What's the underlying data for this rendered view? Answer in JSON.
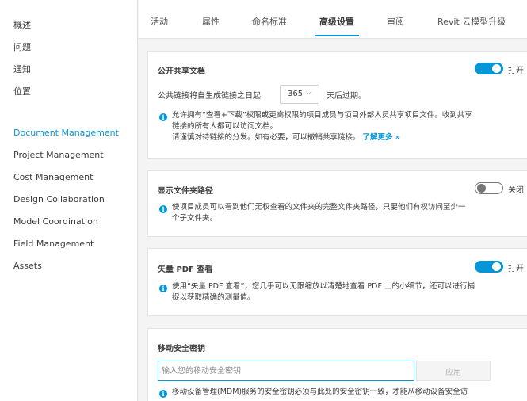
{
  "sidebar": {
    "items": [
      {
        "label": "概述"
      },
      {
        "label": "问题"
      },
      {
        "label": "通知"
      },
      {
        "label": "位置"
      },
      {
        "label": "Document Management",
        "active": true
      },
      {
        "label": "Project Management"
      },
      {
        "label": "Cost Management"
      },
      {
        "label": "Design Collaboration"
      },
      {
        "label": "Model Coordination"
      },
      {
        "label": "Field Management"
      },
      {
        "label": "Assets"
      }
    ]
  },
  "tabs": [
    {
      "label": "活动"
    },
    {
      "label": "属性"
    },
    {
      "label": "命名标准"
    },
    {
      "label": "高级设置",
      "active": true
    },
    {
      "label": "审阅"
    },
    {
      "label": "Revit 云模型升级"
    }
  ],
  "public_sharing": {
    "title": "公开共享文档",
    "toggle_state": "on",
    "toggle_label": "打开",
    "expiry_prefix": "公共链接将自生成链接之日起",
    "expiry_days": "365",
    "expiry_suffix": "天后过期。",
    "info_line1": "允许拥有“查看+下载”权限或更高权限的项目成员与项目外部人员共享项目文件。收到共享",
    "info_line2": "链接的所有人都可以访问文档。",
    "info_line3": "请谨慎对待链接的分发。如有必要，可以撤销共享链接。",
    "learn_more": "了解更多 »"
  },
  "folder_path": {
    "title": "显示文件夹路径",
    "toggle_state": "off",
    "toggle_label": "关闭",
    "info_line1": "使项目成员可以看到他们无权查看的文件夹的完整文件夹路径，只要他们有权访问至少一",
    "info_line2": "个子文件夹。"
  },
  "vector_pdf": {
    "title": "矢量 PDF 查看",
    "toggle_state": "on",
    "toggle_label": "打开",
    "info_line1": "使用“矢量 PDF 查看”，您几乎可以无限缩放以清楚地查看 PDF 上的小细节，还可以进行捕",
    "info_line2": "捉以获取精确的测量值。"
  },
  "mobile_key": {
    "title": "移动安全密钥",
    "input_placeholder": "输入您的移动安全密钥",
    "input_value": "",
    "apply_label": "应用",
    "info_line1": "移动设备管理(MDM)服务的安全密钥必须与此处的安全密钥一致，才能从移动设备安全访"
  },
  "colors": {
    "accent": "#0696d7",
    "text": "#3c3c3c",
    "background": "#f4f4f4"
  },
  "icons": {
    "info": "info-icon",
    "dropdown": "chevron-down-icon"
  }
}
